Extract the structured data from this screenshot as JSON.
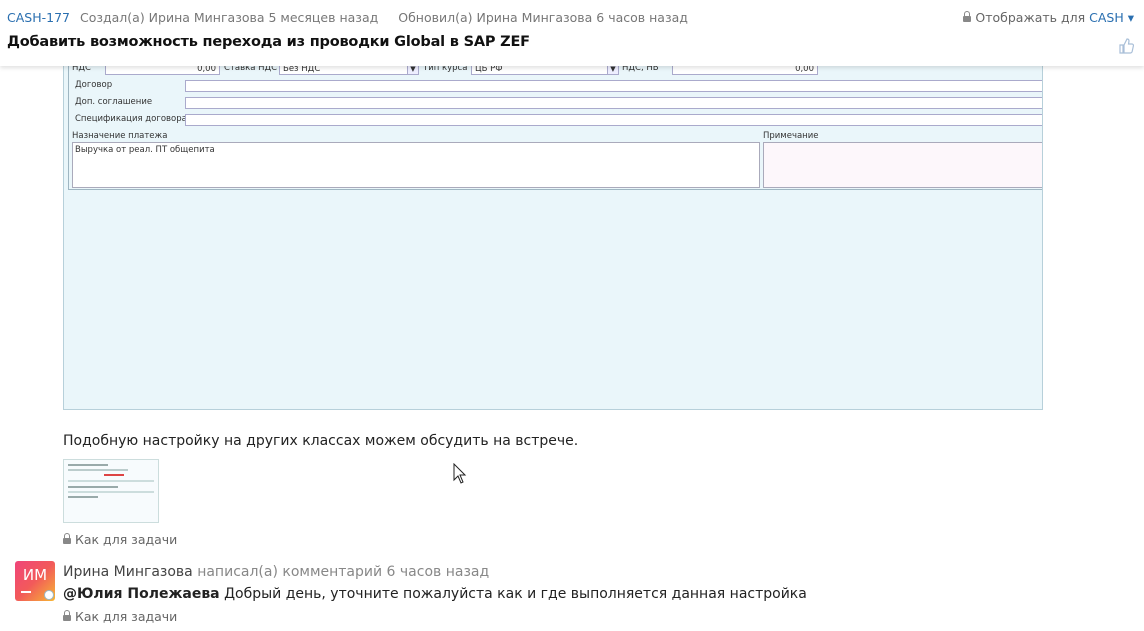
{
  "header": {
    "issue_key": "CASH-177",
    "created": "Создал(а) Ирина Мингазова 5 месяцев назад",
    "updated": "Обновил(а) Ирина Мингазова 6 часов назад",
    "visibility_prefix": "Отображать для",
    "visibility_project": "CASH",
    "title": "Добавить возможность перехода из проводки Global в SAP ZEF"
  },
  "sap_form": {
    "vat_label": "НДС",
    "vat_value": "0,00",
    "vat_rate_label": "Ставка НДС",
    "vat_rate_value": "Без НДС",
    "rate_type_label": "Тип курса",
    "rate_type_value": "ЦБ РФ",
    "vat_nv_label": "НДС, НВ",
    "vat_nv_value": "0,00",
    "contract_label": "Договор",
    "addendum_label": "Доп. соглашение",
    "spec_label": "Спецификация договора",
    "purpose_label": "Назначение платежа",
    "purpose_value": "Выручка от реал. ПТ общепита",
    "note_label": "Примечание"
  },
  "description_text": "Подобную настройку на других классах можем обсудить на встрече.",
  "visibility_label_1": "Как для задачи",
  "comment": {
    "avatar_initials": "ИМ",
    "author": "Ирина Мингазова",
    "action": "написал(а) комментарий 6 часов назад",
    "mention": "@Юлия Полежаева",
    "text": " Добрый день, уточните пожалуйста как и где выполняется данная настройка",
    "visibility_label": "Как для задачи"
  }
}
